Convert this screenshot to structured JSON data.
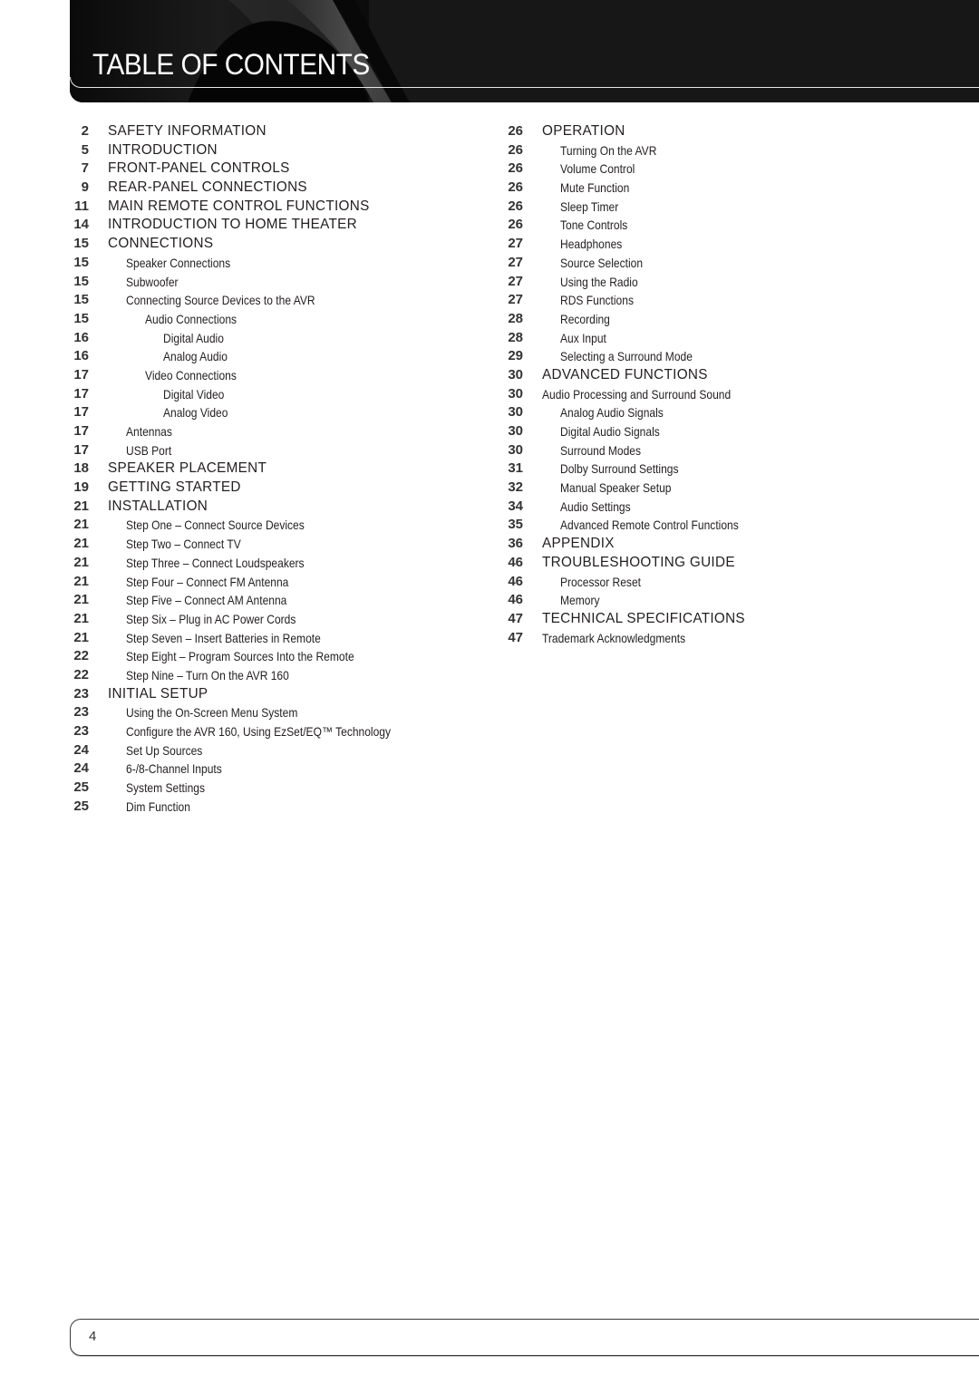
{
  "header": {
    "title": "TABLE OF CONTENTS"
  },
  "toc": {
    "left": [
      {
        "page": "2",
        "title": "SAFETY INFORMATION",
        "level": 0
      },
      {
        "page": "5",
        "title": "INTRODUCTION",
        "level": 0
      },
      {
        "page": "7",
        "title": "FRONT-PANEL CONTROLS",
        "level": 0
      },
      {
        "page": "9",
        "title": "REAR-PANEL CONNECTIONS",
        "level": 0
      },
      {
        "page": "11",
        "title": "MAIN REMOTE CONTROL FUNCTIONS",
        "level": 0
      },
      {
        "page": "14",
        "title": "INTRODUCTION TO HOME THEATER",
        "level": 0
      },
      {
        "page": "15",
        "title": "CONNECTIONS",
        "level": 0
      },
      {
        "page": "15",
        "title": "Speaker Connections",
        "level": 1
      },
      {
        "page": "15",
        "title": "Subwoofer",
        "level": 1
      },
      {
        "page": "15",
        "title": "Connecting Source Devices to the AVR",
        "level": 1
      },
      {
        "page": "15",
        "title": "Audio Connections",
        "level": 2
      },
      {
        "page": "16",
        "title": "Digital Audio",
        "level": 3
      },
      {
        "page": "16",
        "title": "Analog Audio",
        "level": 3
      },
      {
        "page": "17",
        "title": "Video Connections",
        "level": 2
      },
      {
        "page": "17",
        "title": "Digital Video",
        "level": 3
      },
      {
        "page": "17",
        "title": "Analog Video",
        "level": 3
      },
      {
        "page": "17",
        "title": "Antennas",
        "level": 1
      },
      {
        "page": "17",
        "title": "USB Port",
        "level": 1
      },
      {
        "page": "18",
        "title": "SPEAKER PLACEMENT",
        "level": 0
      },
      {
        "page": "19",
        "title": "GETTING STARTED",
        "level": 0
      },
      {
        "page": "21",
        "title": "INSTALLATION",
        "level": 0
      },
      {
        "page": "21",
        "title": "Step One – Connect Source Devices",
        "level": 1
      },
      {
        "page": "21",
        "title": "Step Two – Connect TV",
        "level": 1
      },
      {
        "page": "21",
        "title": "Step Three – Connect Loudspeakers",
        "level": 1
      },
      {
        "page": "21",
        "title": "Step Four – Connect FM Antenna",
        "level": 1
      },
      {
        "page": "21",
        "title": "Step Five – Connect AM Antenna",
        "level": 1
      },
      {
        "page": "21",
        "title": "Step Six – Plug in AC Power Cords",
        "level": 1
      },
      {
        "page": "21",
        "title": "Step Seven – Insert Batteries in Remote",
        "level": 1
      },
      {
        "page": "22",
        "title": "Step Eight – Program Sources Into the Remote",
        "level": 1
      },
      {
        "page": "22",
        "title": "Step Nine – Turn On the AVR 160",
        "level": 1
      },
      {
        "page": "23",
        "title": "INITIAL SETUP",
        "level": 0
      },
      {
        "page": "23",
        "title": "Using the On-Screen Menu System",
        "level": 1
      },
      {
        "page": "23",
        "title": "Configure the AVR 160, Using EzSet/EQ™ Technology",
        "level": 1
      },
      {
        "page": "24",
        "title": "Set Up Sources",
        "level": 1
      },
      {
        "page": "24",
        "title": "6-/8-Channel Inputs",
        "level": 1
      },
      {
        "page": "25",
        "title": "System Settings",
        "level": 1
      },
      {
        "page": "25",
        "title": "Dim Function",
        "level": 1
      }
    ],
    "right": [
      {
        "page": "26",
        "title": "OPERATION",
        "level": 0
      },
      {
        "page": "26",
        "title": "Turning On the AVR",
        "level": 1
      },
      {
        "page": "26",
        "title": "Volume Control",
        "level": 1
      },
      {
        "page": "26",
        "title": "Mute Function",
        "level": 1
      },
      {
        "page": "26",
        "title": "Sleep Timer",
        "level": 1
      },
      {
        "page": "26",
        "title": "Tone Controls",
        "level": 1
      },
      {
        "page": "27",
        "title": "Headphones",
        "level": 1
      },
      {
        "page": "27",
        "title": "Source Selection",
        "level": 1
      },
      {
        "page": "27",
        "title": "Using the Radio",
        "level": 1
      },
      {
        "page": "27",
        "title": "RDS Functions",
        "level": 1
      },
      {
        "page": "28",
        "title": "Recording",
        "level": 1
      },
      {
        "page": "28",
        "title": "Aux Input",
        "level": 1
      },
      {
        "page": "29",
        "title": "Selecting a Surround Mode",
        "level": 1
      },
      {
        "page": "30",
        "title": "ADVANCED FUNCTIONS",
        "level": 0
      },
      {
        "page": "30",
        "title": "Audio Processing and Surround Sound",
        "level": "0s"
      },
      {
        "page": "30",
        "title": "Analog Audio Signals",
        "level": 1
      },
      {
        "page": "30",
        "title": "Digital Audio Signals",
        "level": 1
      },
      {
        "page": "30",
        "title": "Surround Modes",
        "level": 1
      },
      {
        "page": "31",
        "title": "Dolby Surround Settings",
        "level": 1
      },
      {
        "page": "32",
        "title": "Manual Speaker Setup",
        "level": 1
      },
      {
        "page": "34",
        "title": "Audio Settings",
        "level": 1
      },
      {
        "page": "35",
        "title": "Advanced Remote Control Functions",
        "level": 1
      },
      {
        "page": "36",
        "title": "APPENDIX",
        "level": 0
      },
      {
        "page": "46",
        "title": "TROUBLESHOOTING GUIDE",
        "level": 0
      },
      {
        "page": "46",
        "title": "Processor Reset",
        "level": 1
      },
      {
        "page": "46",
        "title": "Memory",
        "level": 1
      },
      {
        "page": "47",
        "title": "TECHNICAL SPECIFICATIONS",
        "level": 0
      },
      {
        "page": "47",
        "title": "Trademark Acknowledgments",
        "level": "0s"
      }
    ]
  },
  "footer": {
    "page_number": "4"
  }
}
